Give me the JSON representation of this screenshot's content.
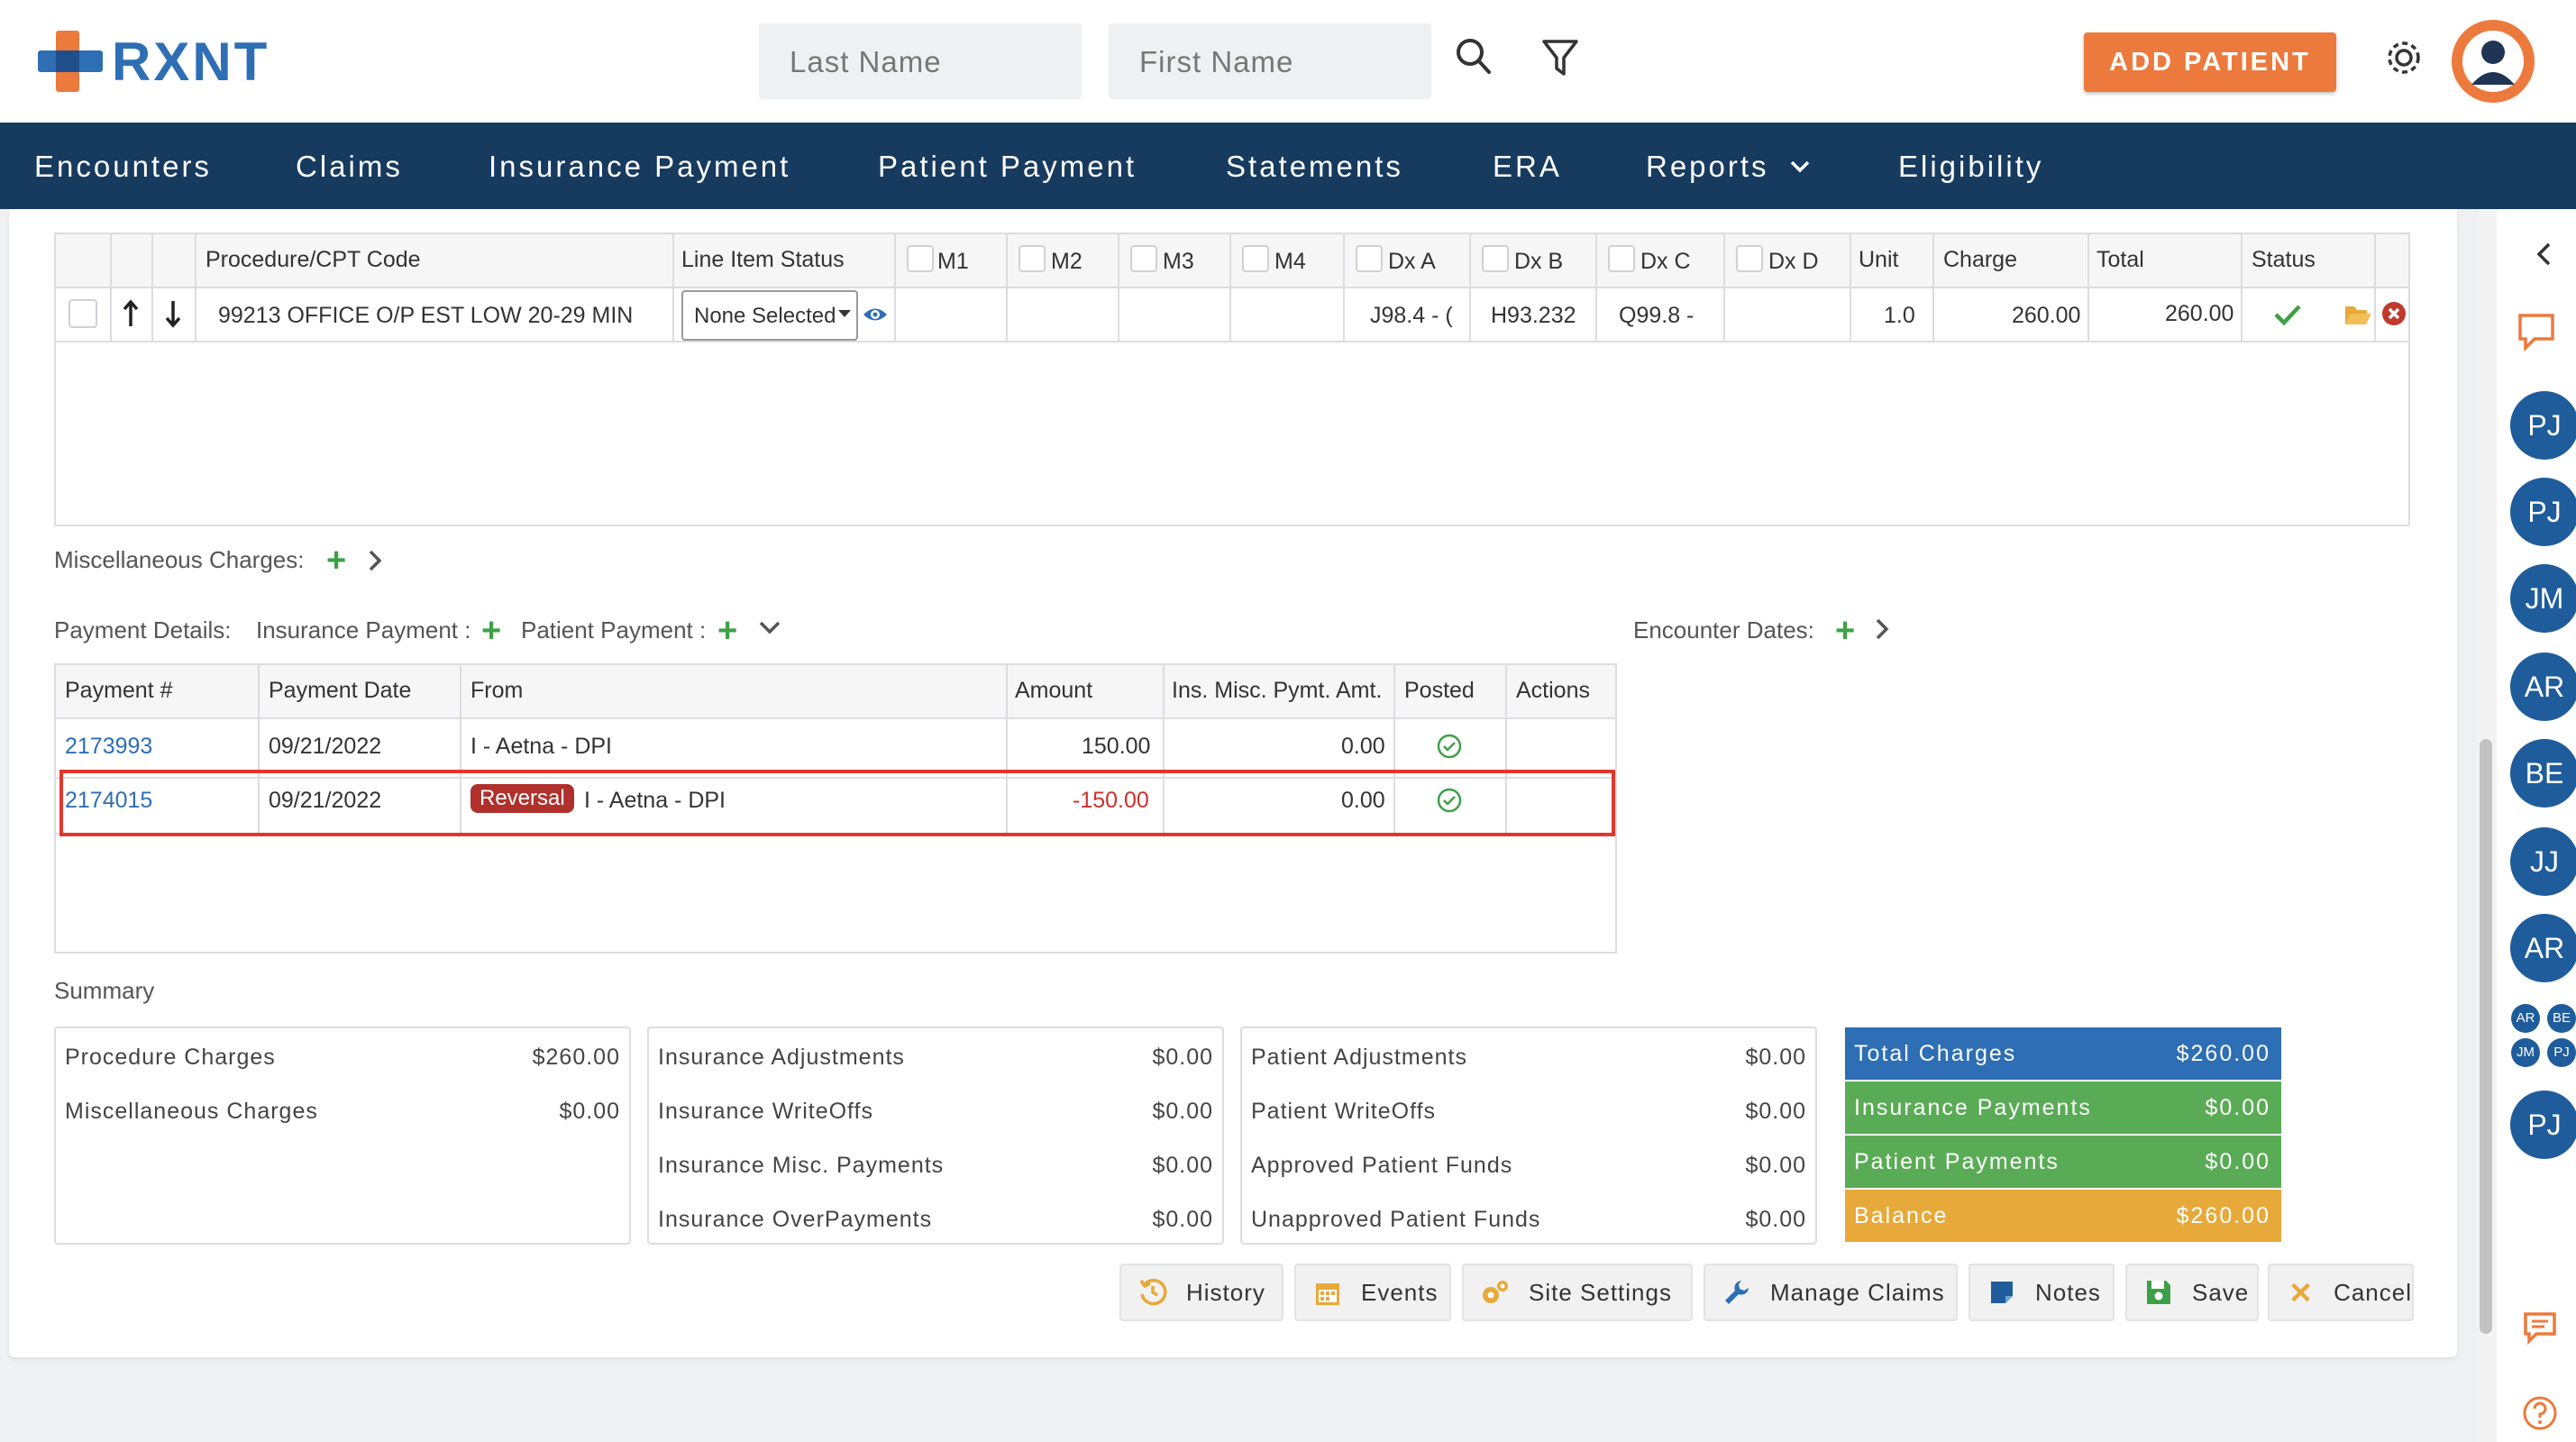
{
  "header": {
    "logo_text": "RXNT",
    "search_last_placeholder": "Last Name",
    "search_first_placeholder": "First Name",
    "add_patient_label": "ADD PATIENT"
  },
  "nav": [
    "Encounters",
    "Claims",
    "Insurance Payment",
    "Patient Payment",
    "Statements",
    "ERA",
    "Reports",
    "Eligibility"
  ],
  "procedures": {
    "headers": {
      "code": "Procedure/CPT Code",
      "status": "Line Item Status",
      "m1": "M1",
      "m2": "M2",
      "m3": "M3",
      "m4": "M4",
      "dxa": "Dx A",
      "dxb": "Dx B",
      "dxc": "Dx C",
      "dxd": "Dx D",
      "unit": "Unit",
      "charge": "Charge",
      "total": "Total",
      "status_col": "Status"
    },
    "rows": [
      {
        "code": "99213 OFFICE O/P EST LOW 20-29 MIN",
        "line_status": "None Selected",
        "dxa": "J98.4 - (",
        "dxb": "H93.232",
        "dxc": "Q99.8 -",
        "unit": "1.0",
        "charge": "260.00",
        "total": "260.00"
      }
    ]
  },
  "misc_label": "Miscellaneous Charges:",
  "payment_details": {
    "label": "Payment Details:",
    "ins_label": "Insurance Payment :",
    "pat_label": "Patient Payment :",
    "encounter_dates": "Encounter Dates:",
    "headers": {
      "num": "Payment #",
      "date": "Payment Date",
      "from": "From",
      "amount": "Amount",
      "misc": "Ins. Misc. Pymt. Amt.",
      "posted": "Posted",
      "actions": "Actions"
    },
    "rows": [
      {
        "num": "2173993",
        "date": "09/21/2022",
        "badge": "",
        "from": "I - Aetna - DPI",
        "amount": "150.00",
        "misc": "0.00"
      },
      {
        "num": "2174015",
        "date": "09/21/2022",
        "badge": "Reversal",
        "from": "I - Aetna - DPI",
        "amount": "-150.00",
        "misc": "0.00"
      }
    ]
  },
  "summary": {
    "title": "Summary",
    "box1": [
      {
        "label": "Procedure Charges",
        "value": "$260.00"
      },
      {
        "label": "Miscellaneous Charges",
        "value": "$0.00"
      }
    ],
    "box2": [
      {
        "label": "Insurance Adjustments",
        "value": "$0.00"
      },
      {
        "label": "Insurance WriteOffs",
        "value": "$0.00"
      },
      {
        "label": "Insurance Misc. Payments",
        "value": "$0.00"
      },
      {
        "label": "Insurance OverPayments",
        "value": "$0.00"
      }
    ],
    "box3": [
      {
        "label": "Patient Adjustments",
        "value": "$0.00"
      },
      {
        "label": "Patient WriteOffs",
        "value": "$0.00"
      },
      {
        "label": "Approved Patient Funds",
        "value": "$0.00"
      },
      {
        "label": "Unapproved Patient Funds",
        "value": "$0.00"
      }
    ],
    "totals": [
      {
        "label": "Total Charges",
        "value": "$260.00",
        "color": "#2e6eb5"
      },
      {
        "label": "Insurance Payments",
        "value": "$0.00",
        "color": "#5aab55"
      },
      {
        "label": "Patient Payments",
        "value": "$0.00",
        "color": "#5aab55"
      },
      {
        "label": "Balance",
        "value": "$260.00",
        "color": "#e7a93a"
      }
    ]
  },
  "footer_buttons": [
    "History",
    "Events",
    "Site Settings",
    "Manage Claims",
    "Notes",
    "Save",
    "Cancel"
  ],
  "rail": {
    "users": [
      "PJ",
      "PJ",
      "JM",
      "AR",
      "BE",
      "JJ",
      "AR"
    ],
    "mini": [
      "AR",
      "BE",
      "JM",
      "PJ"
    ],
    "last": "PJ"
  },
  "colors": {
    "nav": "#173a5f",
    "accent": "#ec7a3c",
    "link": "#2e6eb5",
    "reversal": "#b0312c"
  }
}
